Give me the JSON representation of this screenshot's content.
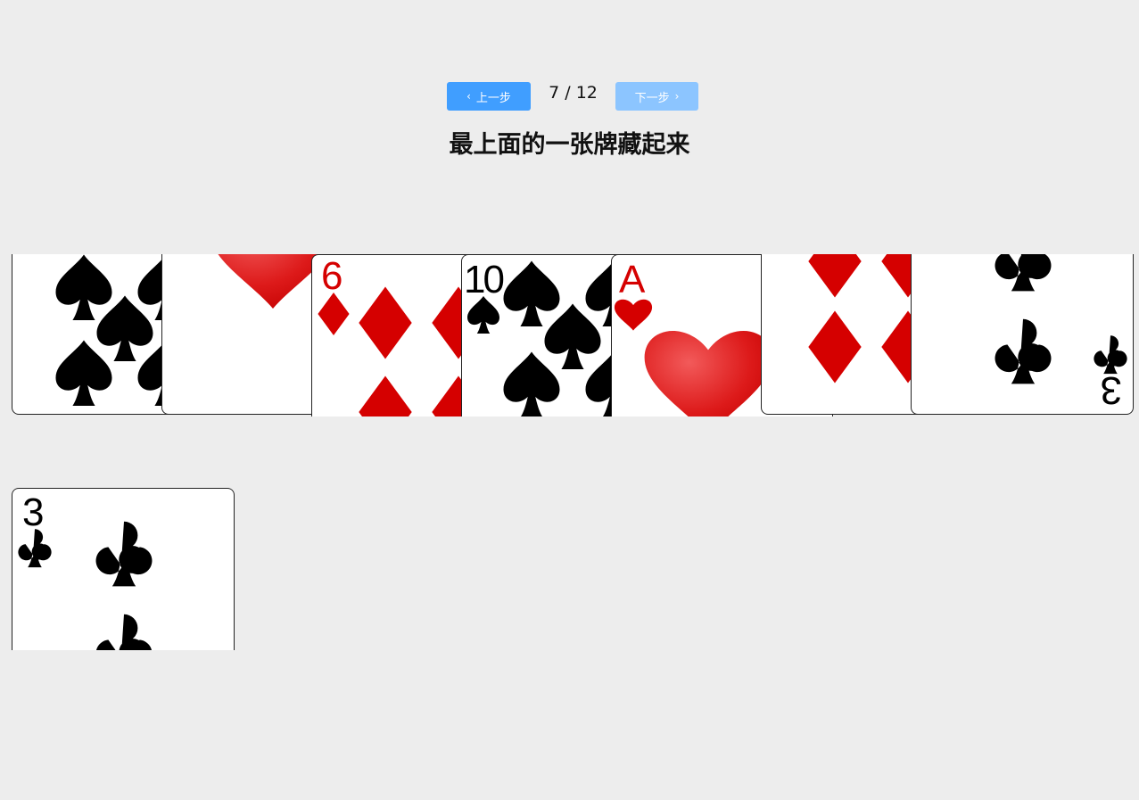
{
  "toolbar": {
    "prev_label": "上一步",
    "next_label": "下一步",
    "step_current": 7,
    "step_total": 12,
    "step_text": "7 / 12",
    "prev_icon": "chevron-left-icon",
    "next_icon": "chevron-right-icon",
    "prev_color": "#409eff",
    "next_color": "#8cc5ff"
  },
  "title": "最上面的一张牌藏起来",
  "cards_row": [
    {
      "suit": "spades",
      "rank": "",
      "color": "#000000"
    },
    {
      "suit": "hearts",
      "rank": "",
      "color": "#d50000"
    },
    {
      "suit": "diamonds",
      "rank": "6",
      "color": "#d50000"
    },
    {
      "suit": "spades",
      "rank": "10",
      "color": "#000000"
    },
    {
      "suit": "hearts",
      "rank": "A",
      "color": "#d50000"
    },
    {
      "suit": "diamonds",
      "rank": "",
      "color": "#d50000"
    },
    {
      "suit": "clubs",
      "rank": "3",
      "color": "#000000"
    }
  ],
  "hidden_card": {
    "suit": "clubs",
    "rank": "3",
    "color": "#000000"
  }
}
